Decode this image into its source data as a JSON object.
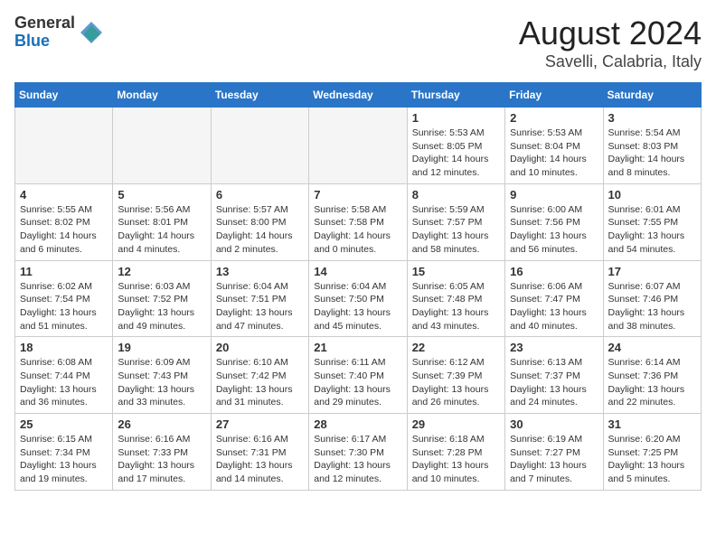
{
  "logo": {
    "general": "General",
    "blue": "Blue"
  },
  "title": "August 2024",
  "subtitle": "Savelli, Calabria, Italy",
  "days_of_week": [
    "Sunday",
    "Monday",
    "Tuesday",
    "Wednesday",
    "Thursday",
    "Friday",
    "Saturday"
  ],
  "weeks": [
    [
      {
        "day": "",
        "info": ""
      },
      {
        "day": "",
        "info": ""
      },
      {
        "day": "",
        "info": ""
      },
      {
        "day": "",
        "info": ""
      },
      {
        "day": "1",
        "info": "Sunrise: 5:53 AM\nSunset: 8:05 PM\nDaylight: 14 hours\nand 12 minutes."
      },
      {
        "day": "2",
        "info": "Sunrise: 5:53 AM\nSunset: 8:04 PM\nDaylight: 14 hours\nand 10 minutes."
      },
      {
        "day": "3",
        "info": "Sunrise: 5:54 AM\nSunset: 8:03 PM\nDaylight: 14 hours\nand 8 minutes."
      }
    ],
    [
      {
        "day": "4",
        "info": "Sunrise: 5:55 AM\nSunset: 8:02 PM\nDaylight: 14 hours\nand 6 minutes."
      },
      {
        "day": "5",
        "info": "Sunrise: 5:56 AM\nSunset: 8:01 PM\nDaylight: 14 hours\nand 4 minutes."
      },
      {
        "day": "6",
        "info": "Sunrise: 5:57 AM\nSunset: 8:00 PM\nDaylight: 14 hours\nand 2 minutes."
      },
      {
        "day": "7",
        "info": "Sunrise: 5:58 AM\nSunset: 7:58 PM\nDaylight: 14 hours\nand 0 minutes."
      },
      {
        "day": "8",
        "info": "Sunrise: 5:59 AM\nSunset: 7:57 PM\nDaylight: 13 hours\nand 58 minutes."
      },
      {
        "day": "9",
        "info": "Sunrise: 6:00 AM\nSunset: 7:56 PM\nDaylight: 13 hours\nand 56 minutes."
      },
      {
        "day": "10",
        "info": "Sunrise: 6:01 AM\nSunset: 7:55 PM\nDaylight: 13 hours\nand 54 minutes."
      }
    ],
    [
      {
        "day": "11",
        "info": "Sunrise: 6:02 AM\nSunset: 7:54 PM\nDaylight: 13 hours\nand 51 minutes."
      },
      {
        "day": "12",
        "info": "Sunrise: 6:03 AM\nSunset: 7:52 PM\nDaylight: 13 hours\nand 49 minutes."
      },
      {
        "day": "13",
        "info": "Sunrise: 6:04 AM\nSunset: 7:51 PM\nDaylight: 13 hours\nand 47 minutes."
      },
      {
        "day": "14",
        "info": "Sunrise: 6:04 AM\nSunset: 7:50 PM\nDaylight: 13 hours\nand 45 minutes."
      },
      {
        "day": "15",
        "info": "Sunrise: 6:05 AM\nSunset: 7:48 PM\nDaylight: 13 hours\nand 43 minutes."
      },
      {
        "day": "16",
        "info": "Sunrise: 6:06 AM\nSunset: 7:47 PM\nDaylight: 13 hours\nand 40 minutes."
      },
      {
        "day": "17",
        "info": "Sunrise: 6:07 AM\nSunset: 7:46 PM\nDaylight: 13 hours\nand 38 minutes."
      }
    ],
    [
      {
        "day": "18",
        "info": "Sunrise: 6:08 AM\nSunset: 7:44 PM\nDaylight: 13 hours\nand 36 minutes."
      },
      {
        "day": "19",
        "info": "Sunrise: 6:09 AM\nSunset: 7:43 PM\nDaylight: 13 hours\nand 33 minutes."
      },
      {
        "day": "20",
        "info": "Sunrise: 6:10 AM\nSunset: 7:42 PM\nDaylight: 13 hours\nand 31 minutes."
      },
      {
        "day": "21",
        "info": "Sunrise: 6:11 AM\nSunset: 7:40 PM\nDaylight: 13 hours\nand 29 minutes."
      },
      {
        "day": "22",
        "info": "Sunrise: 6:12 AM\nSunset: 7:39 PM\nDaylight: 13 hours\nand 26 minutes."
      },
      {
        "day": "23",
        "info": "Sunrise: 6:13 AM\nSunset: 7:37 PM\nDaylight: 13 hours\nand 24 minutes."
      },
      {
        "day": "24",
        "info": "Sunrise: 6:14 AM\nSunset: 7:36 PM\nDaylight: 13 hours\nand 22 minutes."
      }
    ],
    [
      {
        "day": "25",
        "info": "Sunrise: 6:15 AM\nSunset: 7:34 PM\nDaylight: 13 hours\nand 19 minutes."
      },
      {
        "day": "26",
        "info": "Sunrise: 6:16 AM\nSunset: 7:33 PM\nDaylight: 13 hours\nand 17 minutes."
      },
      {
        "day": "27",
        "info": "Sunrise: 6:16 AM\nSunset: 7:31 PM\nDaylight: 13 hours\nand 14 minutes."
      },
      {
        "day": "28",
        "info": "Sunrise: 6:17 AM\nSunset: 7:30 PM\nDaylight: 13 hours\nand 12 minutes."
      },
      {
        "day": "29",
        "info": "Sunrise: 6:18 AM\nSunset: 7:28 PM\nDaylight: 13 hours\nand 10 minutes."
      },
      {
        "day": "30",
        "info": "Sunrise: 6:19 AM\nSunset: 7:27 PM\nDaylight: 13 hours\nand 7 minutes."
      },
      {
        "day": "31",
        "info": "Sunrise: 6:20 AM\nSunset: 7:25 PM\nDaylight: 13 hours\nand 5 minutes."
      }
    ]
  ]
}
